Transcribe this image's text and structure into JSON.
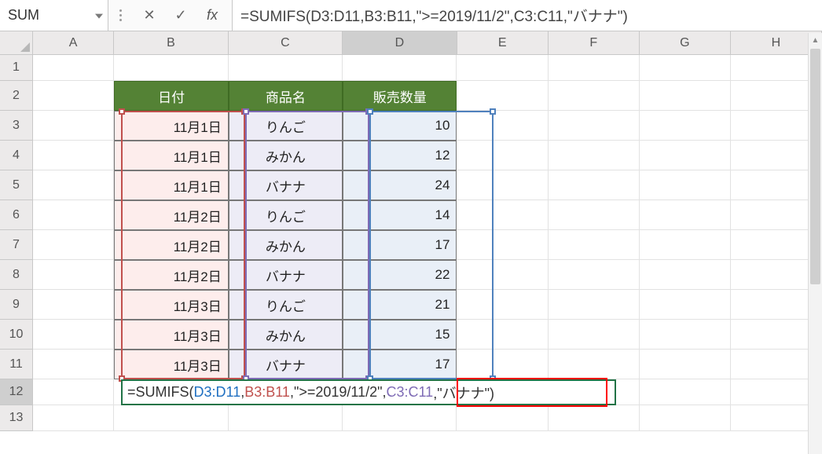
{
  "namebox": {
    "value": "SUM"
  },
  "formula_bar": {
    "cancel": "✕",
    "confirm": "✓",
    "fx": "fx",
    "text": "=SUMIFS(D3:D11,B3:B11,\">=2019/11/2\",C3:C11,\"バナナ\")"
  },
  "columns": [
    "A",
    "B",
    "C",
    "D",
    "E",
    "F",
    "G",
    "H"
  ],
  "rows": [
    "1",
    "2",
    "3",
    "4",
    "5",
    "6",
    "7",
    "8",
    "9",
    "10",
    "11",
    "12",
    "13"
  ],
  "selected_col": "D",
  "selected_row": "12",
  "headers": {
    "b": "日付",
    "c": "商品名",
    "d": "販売数量"
  },
  "table": [
    {
      "b": "11月1日",
      "c": "りんご",
      "d": "10"
    },
    {
      "b": "11月1日",
      "c": "みかん",
      "d": "12"
    },
    {
      "b": "11月1日",
      "c": "バナナ",
      "d": "24"
    },
    {
      "b": "11月2日",
      "c": "りんご",
      "d": "14"
    },
    {
      "b": "11月2日",
      "c": "みかん",
      "d": "17"
    },
    {
      "b": "11月2日",
      "c": "バナナ",
      "d": "22"
    },
    {
      "b": "11月3日",
      "c": "りんご",
      "d": "21"
    },
    {
      "b": "11月3日",
      "c": "みかん",
      "d": "15"
    },
    {
      "b": "11月3日",
      "c": "バナナ",
      "d": "17"
    }
  ],
  "editing_cell": {
    "pre": "=SUMIFS(",
    "r1": "D3:D11",
    "s1": ",",
    "r2": "B3:B11",
    "s2": ",\">=2019/11/2\",",
    "r3": "C3:C11",
    "s3": ",\"バナナ\")"
  }
}
